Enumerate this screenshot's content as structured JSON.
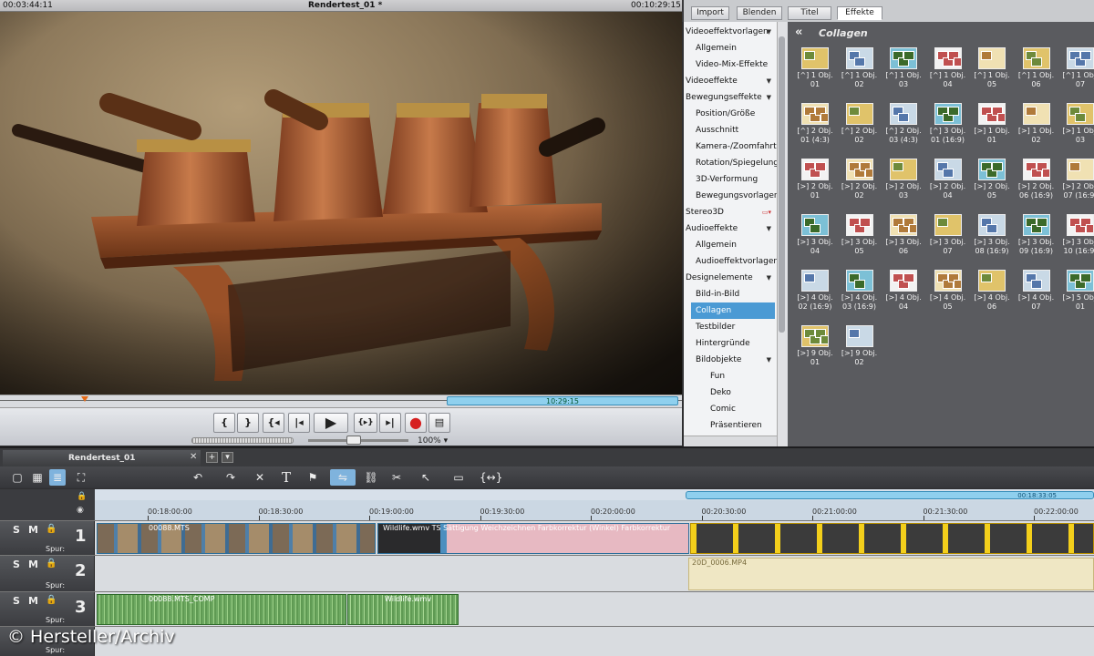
{
  "player": {
    "timecode_left": "00:03:44:11",
    "project_title": "Rendertest_01 *",
    "timecode_right": "00:10:29:15",
    "range_label": "10:29:15",
    "zoom": "100%",
    "transport_buttons": [
      "{",
      "}",
      "{◂",
      "|◂",
      "▶",
      "{▸}",
      "▸|",
      "●",
      "▤"
    ]
  },
  "media_pool": {
    "tabs": [
      "Import",
      "Blenden",
      "Titel",
      "Effekte"
    ],
    "active_tab": "Effekte",
    "categories": [
      {
        "label": "Videoeffektvorlagen",
        "level": 0
      },
      {
        "label": "Allgemein",
        "level": 1
      },
      {
        "label": "Video-Mix-Effekte",
        "level": 1
      },
      {
        "label": "Videoeffekte",
        "level": 0
      },
      {
        "label": "Bewegungseffekte",
        "level": 0
      },
      {
        "label": "Position/Größe",
        "level": 1
      },
      {
        "label": "Ausschnitt",
        "level": 1
      },
      {
        "label": "Kamera-/Zoomfahrt",
        "level": 1
      },
      {
        "label": "Rotation/Spiegelung",
        "level": 1
      },
      {
        "label": "3D-Verformung",
        "level": 1
      },
      {
        "label": "Bewegungsvorlagen",
        "level": 1
      },
      {
        "label": "Stereo3D",
        "level": 0
      },
      {
        "label": "Audioeffekte",
        "level": 0
      },
      {
        "label": "Allgemein",
        "level": 1
      },
      {
        "label": "Audioeffektvorlagen",
        "level": 1
      },
      {
        "label": "Designelemente",
        "level": 0
      },
      {
        "label": "Bild-in-Bild",
        "level": 1
      },
      {
        "label": "Collagen",
        "level": 1
      },
      {
        "label": "Testbilder",
        "level": 1
      },
      {
        "label": "Hintergründe",
        "level": 1
      },
      {
        "label": "Bildobjekte",
        "level": 1
      },
      {
        "label": "Fun",
        "level": 2
      },
      {
        "label": "Deko",
        "level": 2
      },
      {
        "label": "Comic",
        "level": 2
      },
      {
        "label": "Präsentieren",
        "level": 2
      }
    ],
    "selected_category": "Collagen",
    "effects_heading": "Collagen",
    "effects": [
      [
        "[^] 1 Obj.",
        "01"
      ],
      [
        "[^] 1 Obj.",
        "02"
      ],
      [
        "[^] 1 Obj.",
        "03"
      ],
      [
        "[^] 1 Obj.",
        "04"
      ],
      [
        "[^] 1 Obj.",
        "05"
      ],
      [
        "[^] 1 Obj.",
        "06"
      ],
      [
        "[^] 1 Obj.",
        "07"
      ],
      [
        "[^] 2 Obj.",
        "01 (4:3)"
      ],
      [
        "[^] 2 Obj.",
        "02"
      ],
      [
        "[^] 2 Obj.",
        "03 (4:3)"
      ],
      [
        "[^] 3 Obj.",
        "01 (16:9)"
      ],
      [
        "[>] 1 Obj.",
        "01"
      ],
      [
        "[>] 1 Obj.",
        "02"
      ],
      [
        "[>] 1 Obj.",
        "03"
      ],
      [
        "[>] 2 Obj.",
        "01"
      ],
      [
        "[>] 2 Obj.",
        "02"
      ],
      [
        "[>] 2 Obj.",
        "03"
      ],
      [
        "[>] 2 Obj.",
        "04"
      ],
      [
        "[>] 2 Obj.",
        "05"
      ],
      [
        "[>] 2 Obj.",
        "06 (16:9)"
      ],
      [
        "[>] 2 Obj.",
        "07 (16:9)"
      ],
      [
        "[>] 3 Obj.",
        "04"
      ],
      [
        "[>] 3 Obj.",
        "05"
      ],
      [
        "[>] 3 Obj.",
        "06"
      ],
      [
        "[>] 3 Obj.",
        "07"
      ],
      [
        "[>] 3 Obj.",
        "08 (16:9)"
      ],
      [
        "[>] 3 Obj.",
        "09 (16:9)"
      ],
      [
        "[>] 3 Obj.",
        "10 (16:9)"
      ],
      [
        "[>] 4 Obj.",
        "02 (16:9)"
      ],
      [
        "[>] 4 Obj.",
        "03 (16:9)"
      ],
      [
        "[>] 4 Obj.",
        "04"
      ],
      [
        "[>] 4 Obj.",
        "05"
      ],
      [
        "[>] 4 Obj.",
        "06"
      ],
      [
        "[>] 4 Obj.",
        "07"
      ],
      [
        "[>] 5 Obj.",
        "01"
      ],
      [
        "[>] 9 Obj.",
        "01"
      ],
      [
        "[>] 9 Obj.",
        "02"
      ]
    ]
  },
  "timeline": {
    "tab_label": "Rendertest_01",
    "ruler_range_label": "00:18:33:05",
    "ticks": [
      "00:18:00:00",
      "00:18:30:00",
      "00:19:00:00",
      "00:19:30:00",
      "00:20:00:00",
      "00:20:30:00",
      "00:21:00:00",
      "00:21:30:00",
      "00:22:00:00"
    ],
    "track_labels": {
      "solo": "S",
      "mute": "M",
      "lock": "🔒",
      "track": "Spur:"
    },
    "tracks": [
      {
        "number": "1",
        "clips": [
          "00088.MTS",
          "Wildlife.wmv TS  Sättigung  Weichzeichnen  Farbkorrektur (Winkel)  Farbkorrektur"
        ]
      },
      {
        "number": "2",
        "clips": [
          "20D_0006.MP4"
        ]
      },
      {
        "number": "3",
        "clips": [
          "00088.MTS_COMP",
          "Wildlife.wmv"
        ]
      }
    ]
  },
  "watermark": "© Hersteller/Archiv",
  "colors": {
    "accent": "#4b9ad4",
    "range": "#8fd0ee",
    "playhead": "#e46a17",
    "record": "#d62020"
  }
}
